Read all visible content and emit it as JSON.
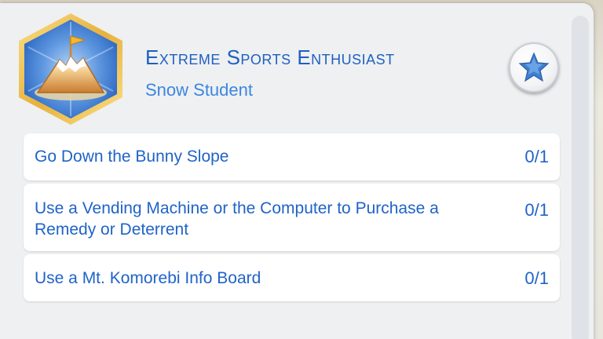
{
  "aspiration": {
    "title": "Extreme Sports Enthusiast",
    "subtitle": "Snow Student",
    "badge_icon": "mountain-flag-icon",
    "action_icon": "star-icon"
  },
  "tasks": [
    {
      "text": "Go Down the Bunny Slope",
      "progress": "0/1"
    },
    {
      "text": "Use a Vending Machine or the Computer to Purchase a Remedy or Deterrent",
      "progress": "0/1"
    },
    {
      "text": "Use a Mt. Komorebi Info Board",
      "progress": "0/1"
    }
  ],
  "colors": {
    "title": "#1f5fc0",
    "subtitle": "#3d86de",
    "task_text": "#1f63c8",
    "panel": "#eef0f2",
    "badge_border": "#f2c85a",
    "badge_fill": "#4a86d8"
  }
}
